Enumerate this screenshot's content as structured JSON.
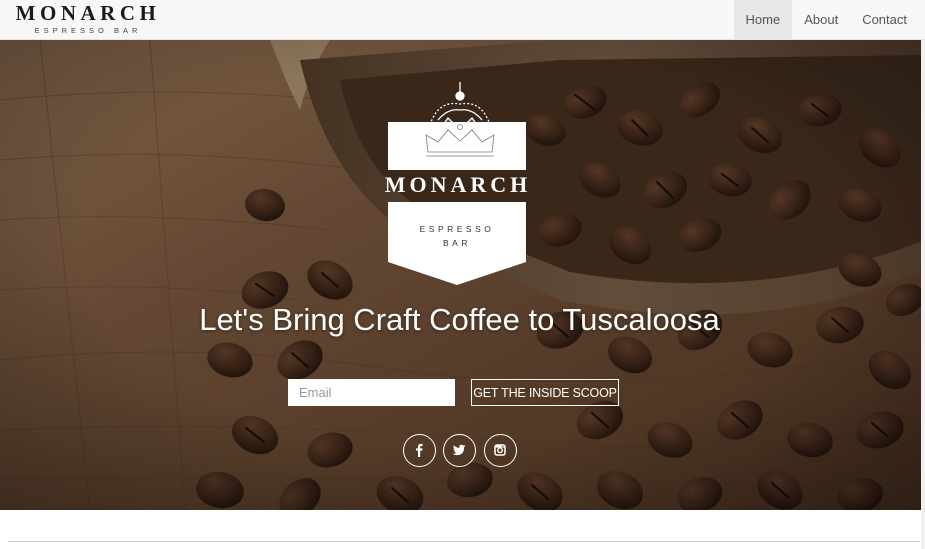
{
  "navbar": {
    "brand_name": "MONARCH",
    "brand_sub": "ESPRESSO BAR",
    "items": [
      {
        "label": "Home",
        "active": true
      },
      {
        "label": "About",
        "active": false
      },
      {
        "label": "Contact",
        "active": false
      }
    ]
  },
  "hero": {
    "logo": {
      "name": "MONARCH",
      "sub_line1": "ESPRESSO",
      "sub_line2": "BAR"
    },
    "title": "Let's Bring Craft Coffee to Tuscaloosa",
    "signup": {
      "email_placeholder": "Email",
      "email_value": "",
      "button_label": "GET THE INSIDE SCOOP"
    },
    "social": [
      {
        "icon": "facebook-icon"
      },
      {
        "icon": "twitter-icon"
      },
      {
        "icon": "instagram-icon"
      }
    ]
  },
  "colors": {
    "nav_bg": "#f8f8f8",
    "nav_active_bg": "#e7e7e7",
    "hero_text": "#ffffff",
    "wood": "#5a3f2b",
    "bean": "#2a1a12"
  }
}
